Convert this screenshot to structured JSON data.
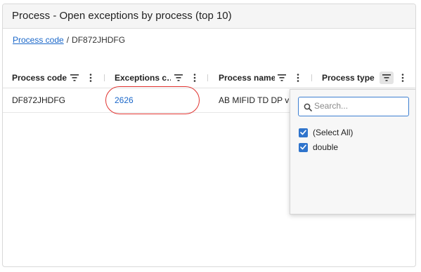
{
  "panel": {
    "title": "Process - Open exceptions by process (top 10)"
  },
  "breadcrumb": {
    "root_link": "Process code",
    "separator": "/",
    "current": "DF872JHDFG"
  },
  "grid": {
    "columns": [
      {
        "label": "Process code"
      },
      {
        "label": "Exceptions c…"
      },
      {
        "label": "Process name"
      },
      {
        "label": "Process type"
      }
    ],
    "rows": [
      {
        "process_code": "DF872JHDFG",
        "exceptions_count": "2626",
        "process_name": "AB MIFID TD DP ver",
        "process_type": ""
      }
    ]
  },
  "filter_popup": {
    "search_placeholder": "Search...",
    "options": [
      {
        "label": "(Select All)",
        "checked": true
      },
      {
        "label": "double",
        "checked": true
      }
    ]
  },
  "colors": {
    "link": "#1a67c9",
    "checkbox": "#2f74cc",
    "highlight": "#e0322f",
    "search_border": "#3d7fd1"
  },
  "icons": {
    "filter": "filter-icon",
    "menu": "kebab-menu-icon",
    "search": "search-icon",
    "check": "check-icon"
  }
}
